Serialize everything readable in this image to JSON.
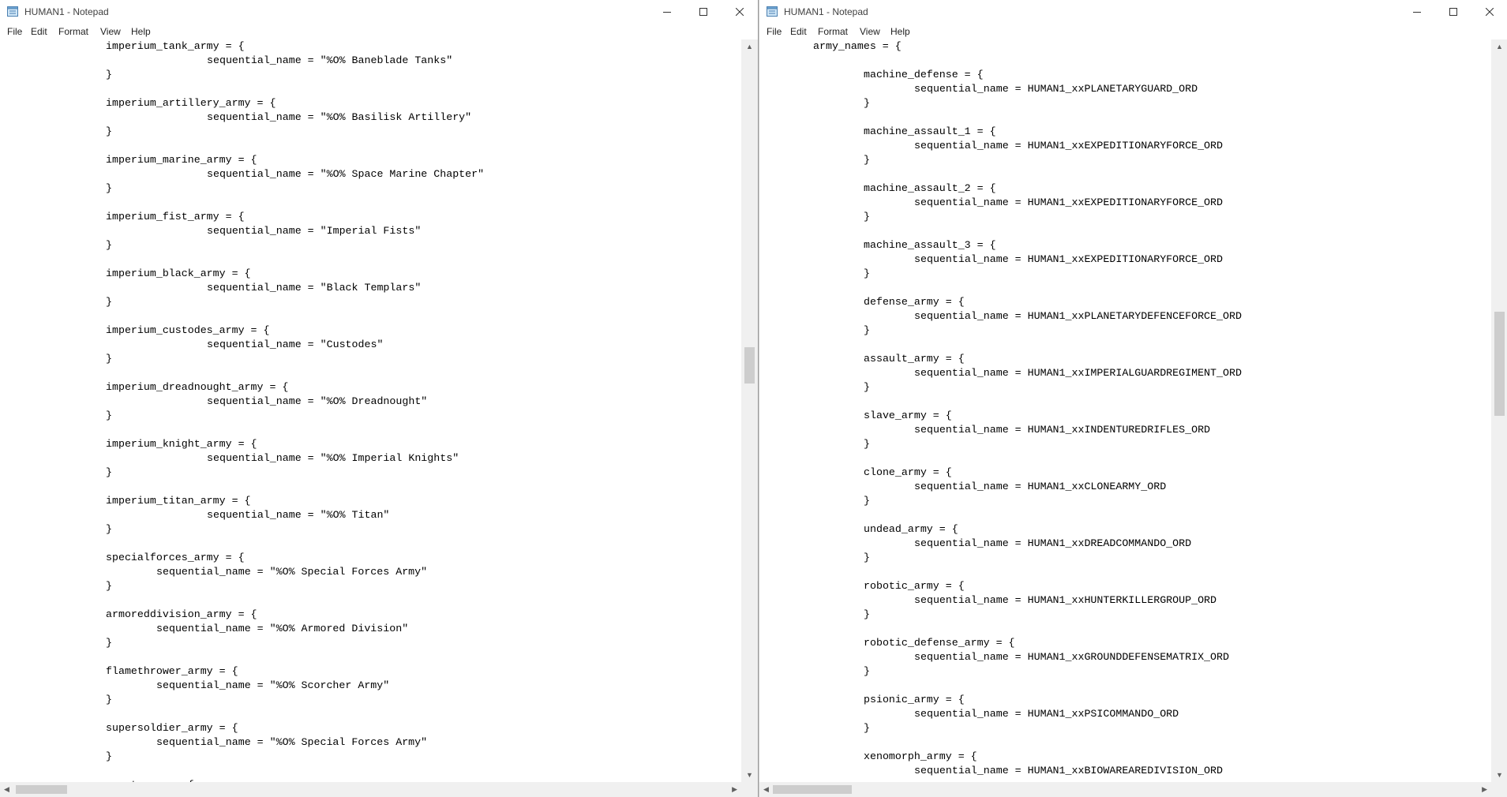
{
  "windows": [
    {
      "id": "left",
      "title": "HUMAN1 - Notepad",
      "menu": [
        "File",
        "Edit",
        "Format",
        "View",
        "Help"
      ],
      "lines": [
        {
          "indent": 0,
          "text": "imperium_tank_army = {"
        },
        {
          "indent": 2,
          "text": "sequential_name = \"%O% Baneblade Tanks\""
        },
        {
          "indent": 0,
          "text": "}"
        },
        {
          "indent": 0,
          "text": ""
        },
        {
          "indent": 0,
          "text": "imperium_artillery_army = {"
        },
        {
          "indent": 2,
          "text": "sequential_name = \"%O% Basilisk Artillery\""
        },
        {
          "indent": 0,
          "text": "}"
        },
        {
          "indent": 0,
          "text": ""
        },
        {
          "indent": 0,
          "text": "imperium_marine_army = {"
        },
        {
          "indent": 2,
          "text": "sequential_name = \"%O% Space Marine Chapter\""
        },
        {
          "indent": 0,
          "text": "}"
        },
        {
          "indent": 0,
          "text": ""
        },
        {
          "indent": 0,
          "text": "imperium_fist_army = {"
        },
        {
          "indent": 2,
          "text": "sequential_name = \"Imperial Fists\""
        },
        {
          "indent": 0,
          "text": "}"
        },
        {
          "indent": 0,
          "text": ""
        },
        {
          "indent": 0,
          "text": "imperium_black_army = {"
        },
        {
          "indent": 2,
          "text": "sequential_name = \"Black Templars\""
        },
        {
          "indent": 0,
          "text": "}"
        },
        {
          "indent": 0,
          "text": ""
        },
        {
          "indent": 0,
          "text": "imperium_custodes_army = {"
        },
        {
          "indent": 2,
          "text": "sequential_name = \"Custodes\""
        },
        {
          "indent": 0,
          "text": "}"
        },
        {
          "indent": 0,
          "text": ""
        },
        {
          "indent": 0,
          "text": "imperium_dreadnought_army = {"
        },
        {
          "indent": 2,
          "text": "sequential_name = \"%O% Dreadnought\""
        },
        {
          "indent": 0,
          "text": "}"
        },
        {
          "indent": 0,
          "text": ""
        },
        {
          "indent": 0,
          "text": "imperium_knight_army = {"
        },
        {
          "indent": 2,
          "text": "sequential_name = \"%O% Imperial Knights\""
        },
        {
          "indent": 0,
          "text": "}"
        },
        {
          "indent": 0,
          "text": ""
        },
        {
          "indent": 0,
          "text": "imperium_titan_army = {"
        },
        {
          "indent": 2,
          "text": "sequential_name = \"%O% Titan\""
        },
        {
          "indent": 0,
          "text": "}"
        },
        {
          "indent": 0,
          "text": ""
        },
        {
          "indent": 0,
          "text": "specialforces_army = {"
        },
        {
          "indent": 1,
          "text": "sequential_name = \"%O% Special Forces Army\""
        },
        {
          "indent": 0,
          "text": "}"
        },
        {
          "indent": 0,
          "text": ""
        },
        {
          "indent": 0,
          "text": "armoreddivision_army = {"
        },
        {
          "indent": 1,
          "text": "sequential_name = \"%O% Armored Division\""
        },
        {
          "indent": 0,
          "text": "}"
        },
        {
          "indent": 0,
          "text": ""
        },
        {
          "indent": 0,
          "text": "flamethrower_army = {"
        },
        {
          "indent": 1,
          "text": "sequential_name = \"%O% Scorcher Army\""
        },
        {
          "indent": 0,
          "text": "}"
        },
        {
          "indent": 0,
          "text": ""
        },
        {
          "indent": 0,
          "text": "supersoldier_army = {"
        },
        {
          "indent": 1,
          "text": "sequential_name = \"%O% Special Forces Army\""
        },
        {
          "indent": 0,
          "text": "}"
        },
        {
          "indent": 0,
          "text": ""
        },
        {
          "indent": 0,
          "text": "grunt_army = {"
        }
      ]
    },
    {
      "id": "right",
      "title": "HUMAN1 - Notepad",
      "menu": [
        "File",
        "Edit",
        "Format",
        "View",
        "Help"
      ],
      "lines": [
        {
          "indent": 0,
          "text": "army_names = {"
        },
        {
          "indent": 0,
          "text": ""
        },
        {
          "indent": 1,
          "text": "machine_defense = {"
        },
        {
          "indent": 2,
          "text": "sequential_name = HUMAN1_xxPLANETARYGUARD_ORD"
        },
        {
          "indent": 1,
          "text": "}"
        },
        {
          "indent": 0,
          "text": ""
        },
        {
          "indent": 1,
          "text": "machine_assault_1 = {"
        },
        {
          "indent": 2,
          "text": "sequential_name = HUMAN1_xxEXPEDITIONARYFORCE_ORD"
        },
        {
          "indent": 1,
          "text": "}"
        },
        {
          "indent": 0,
          "text": ""
        },
        {
          "indent": 1,
          "text": "machine_assault_2 = {"
        },
        {
          "indent": 2,
          "text": "sequential_name = HUMAN1_xxEXPEDITIONARYFORCE_ORD"
        },
        {
          "indent": 1,
          "text": "}"
        },
        {
          "indent": 0,
          "text": ""
        },
        {
          "indent": 1,
          "text": "machine_assault_3 = {"
        },
        {
          "indent": 2,
          "text": "sequential_name = HUMAN1_xxEXPEDITIONARYFORCE_ORD"
        },
        {
          "indent": 1,
          "text": "}"
        },
        {
          "indent": 0,
          "text": ""
        },
        {
          "indent": 1,
          "text": "defense_army = {"
        },
        {
          "indent": 2,
          "text": "sequential_name = HUMAN1_xxPLANETARYDEFENCEFORCE_ORD"
        },
        {
          "indent": 1,
          "text": "}"
        },
        {
          "indent": 0,
          "text": ""
        },
        {
          "indent": 1,
          "text": "assault_army = {"
        },
        {
          "indent": 2,
          "text": "sequential_name = HUMAN1_xxIMPERIALGUARDREGIMENT_ORD"
        },
        {
          "indent": 1,
          "text": "}"
        },
        {
          "indent": 0,
          "text": ""
        },
        {
          "indent": 1,
          "text": "slave_army = {"
        },
        {
          "indent": 2,
          "text": "sequential_name = HUMAN1_xxINDENTUREDRIFLES_ORD"
        },
        {
          "indent": 1,
          "text": "}"
        },
        {
          "indent": 0,
          "text": ""
        },
        {
          "indent": 1,
          "text": "clone_army = {"
        },
        {
          "indent": 2,
          "text": "sequential_name = HUMAN1_xxCLONEARMY_ORD"
        },
        {
          "indent": 1,
          "text": "}"
        },
        {
          "indent": 0,
          "text": ""
        },
        {
          "indent": 1,
          "text": "undead_army = {"
        },
        {
          "indent": 2,
          "text": "sequential_name = HUMAN1_xxDREADCOMMANDO_ORD"
        },
        {
          "indent": 1,
          "text": "}"
        },
        {
          "indent": 0,
          "text": ""
        },
        {
          "indent": 1,
          "text": "robotic_army = {"
        },
        {
          "indent": 2,
          "text": "sequential_name = HUMAN1_xxHUNTERKILLERGROUP_ORD"
        },
        {
          "indent": 1,
          "text": "}"
        },
        {
          "indent": 0,
          "text": ""
        },
        {
          "indent": 1,
          "text": "robotic_defense_army = {"
        },
        {
          "indent": 2,
          "text": "sequential_name = HUMAN1_xxGROUNDDEFENSEMATRIX_ORD"
        },
        {
          "indent": 1,
          "text": "}"
        },
        {
          "indent": 0,
          "text": ""
        },
        {
          "indent": 1,
          "text": "psionic_army = {"
        },
        {
          "indent": 2,
          "text": "sequential_name = HUMAN1_xxPSICOMMANDO_ORD"
        },
        {
          "indent": 1,
          "text": "}"
        },
        {
          "indent": 0,
          "text": ""
        },
        {
          "indent": 1,
          "text": "xenomorph_army = {"
        },
        {
          "indent": 2,
          "text": "sequential_name = HUMAN1_xxBIOWAREAREDIVISION_ORD"
        }
      ]
    }
  ]
}
